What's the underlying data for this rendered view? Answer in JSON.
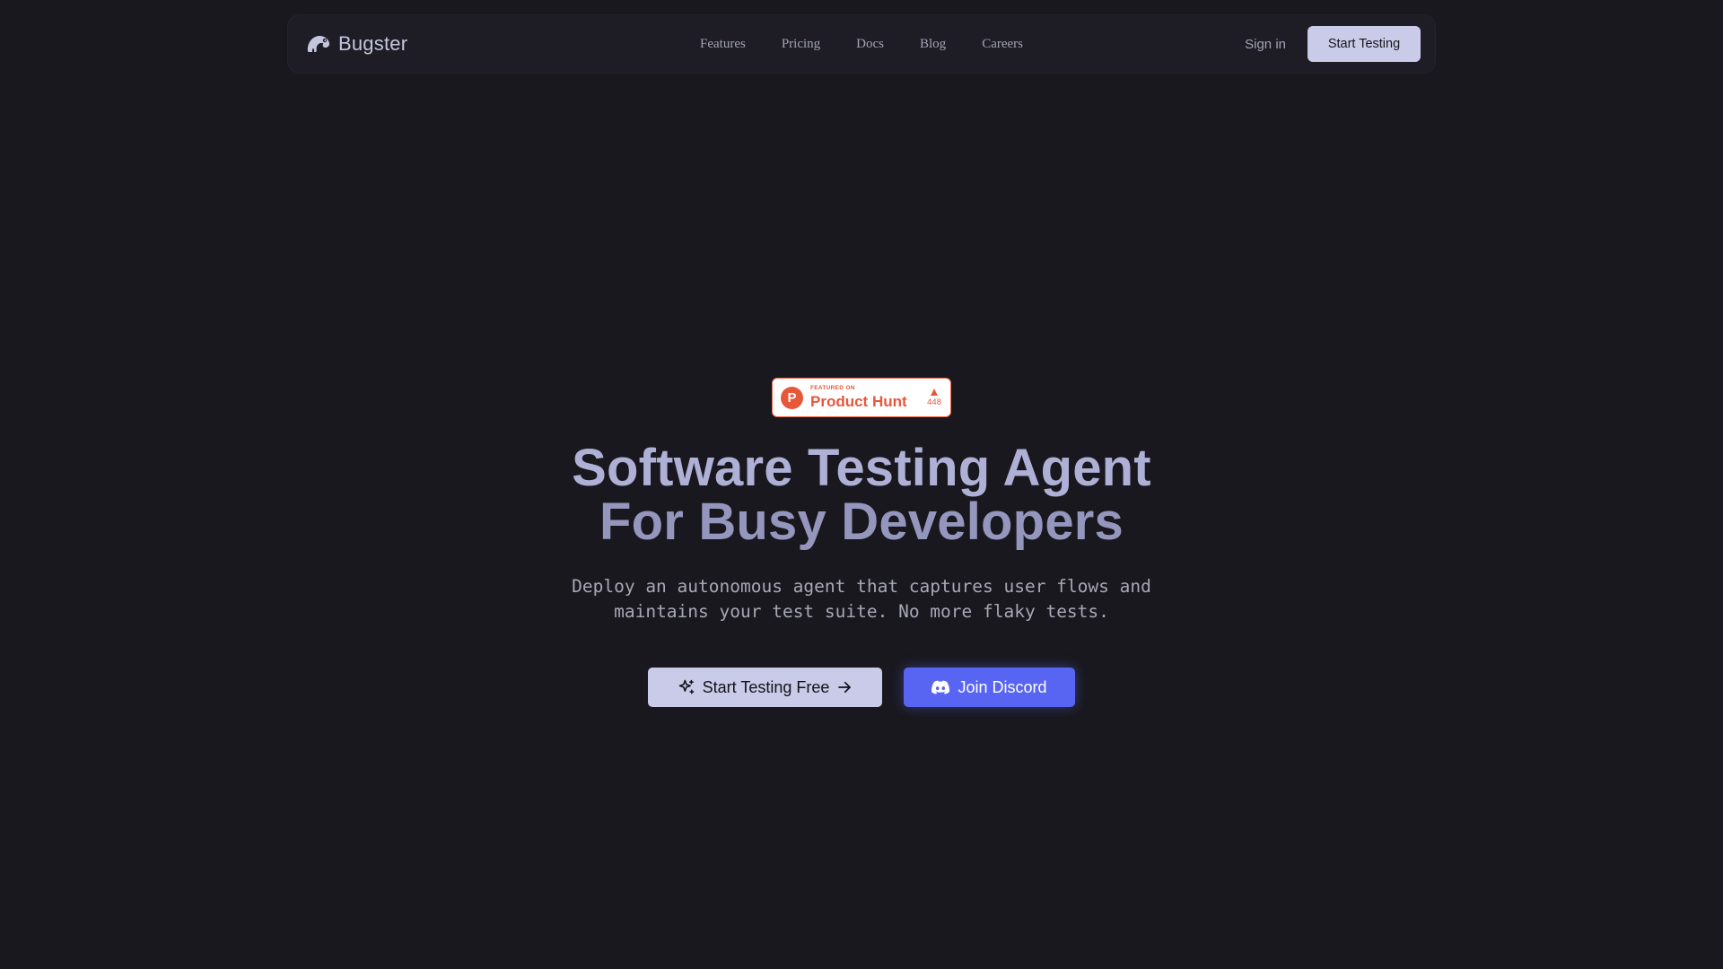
{
  "nav": {
    "brand": "Bugster",
    "links": [
      "Features",
      "Pricing",
      "Docs",
      "Blog",
      "Careers"
    ],
    "sign_in": "Sign in",
    "cta": "Start Testing"
  },
  "badge": {
    "featured": "FEATURED ON",
    "name": "Product Hunt",
    "votes": "448"
  },
  "hero": {
    "title_line1": "Software Testing Agent",
    "title_line2": "For Busy Developers",
    "subtitle_line1": "Deploy an autonomous agent that captures user flows and",
    "subtitle_line2": "maintains your test suite. No more flaky tests.",
    "primary_button": "Start Testing Free",
    "discord_button": "Join Discord"
  },
  "colors": {
    "background": "#19181e",
    "accent": "#c9cbe8",
    "discord": "#5865f2",
    "product_hunt": "#e7573a"
  },
  "icons": {
    "logo": "chameleon-logo-icon",
    "sparkle": "sparkles-icon",
    "arrow": "arrow-right-icon",
    "discord": "discord-icon",
    "upvote": "upvote-triangle-icon"
  }
}
